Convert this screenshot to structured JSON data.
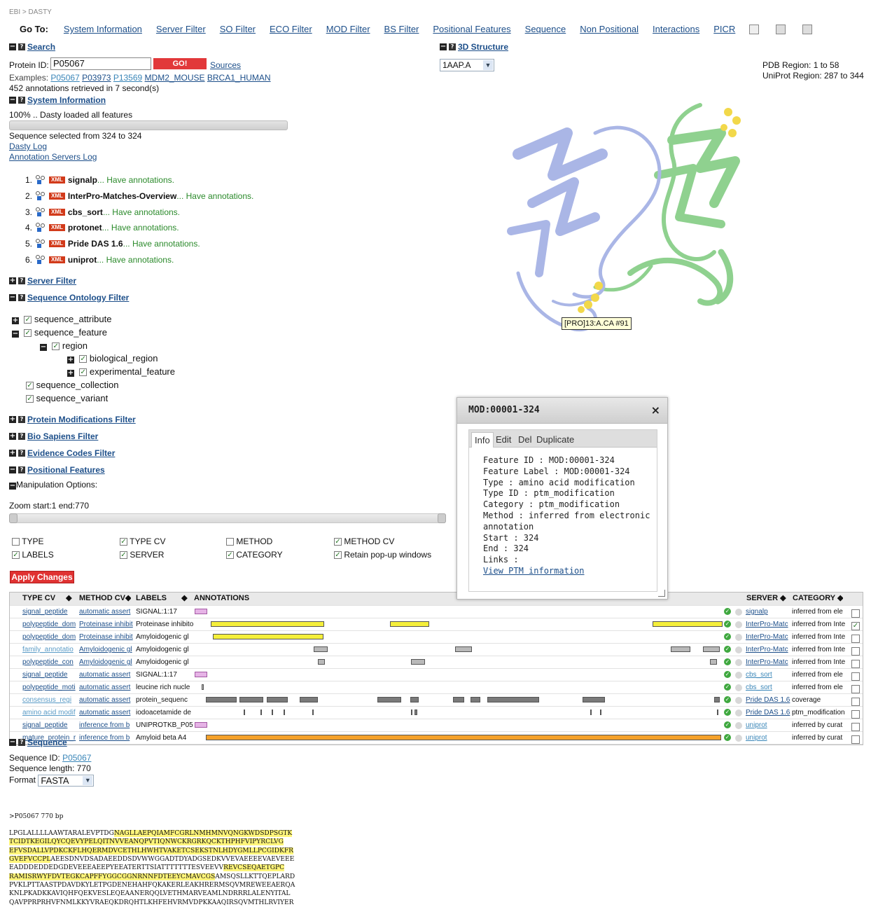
{
  "breadcrumb": "EBI > DASTY",
  "nav": {
    "label": "Go To:",
    "links": [
      "System Information",
      "Server Filter",
      "SO Filter",
      "ECO Filter",
      "MOD Filter",
      "BS Filter",
      "Positional Features",
      "Sequence",
      "Non Positional",
      "Interactions",
      "PICR"
    ]
  },
  "search": {
    "title": "Search",
    "protein_label": "Protein ID:",
    "protein_value": "P05067",
    "go_label": "GO!",
    "sources_label": "Sources",
    "examples_label": "Examples:",
    "examples": [
      "P05067",
      "P03973",
      "P13569",
      "MDM2_MOUSE",
      "BRCA1_HUMAN"
    ],
    "retrieved": "452 annotations retrieved in 7 second(s)"
  },
  "sysinfo": {
    "title": "System Information",
    "loaded": "100% .. Dasty loaded all features",
    "selected": "Sequence selected from 324 to 324",
    "dasty_log": "Dasty Log",
    "servers_log": "Annotation Servers Log",
    "sources": [
      {
        "num": "1.",
        "name": "signalp",
        "status": "... Have annotations.",
        "bold": true
      },
      {
        "num": "2.",
        "name": "InterPro-Matches-Overview",
        "status": "... Have annotations.",
        "bold": true
      },
      {
        "num": "3.",
        "name": "cbs_sort",
        "status": "... Have annotations.",
        "bold": true
      },
      {
        "num": "4.",
        "name": "protonet",
        "status": "... Have annotations.",
        "bold": true
      },
      {
        "num": "5.",
        "name": "Pride DAS 1.6",
        "status": "... Have annotations.",
        "bold": true
      },
      {
        "num": "6.",
        "name": "uniprot",
        "status": "... Have annotations.",
        "bold": true
      }
    ],
    "xml_badge": "XML"
  },
  "filters": {
    "server": "Server Filter",
    "so": "Sequence Ontology Filter",
    "tree": [
      "sequence_attribute",
      "sequence_feature",
      "region",
      "biological_region",
      "experimental_feature",
      "sequence_collection",
      "sequence_variant"
    ],
    "protmod": "Protein Modifications Filter",
    "biosap": "Bio Sapiens Filter",
    "evidence": "Evidence Codes Filter",
    "positional": "Positional Features"
  },
  "manipulation": {
    "title": "Manipulation Options:",
    "zoom": "Zoom start:1 end:770",
    "options": [
      "TYPE",
      "TYPE CV",
      "METHOD",
      "METHOD CV",
      "LABELS",
      "SERVER",
      "CATEGORY",
      "Retain pop-up windows"
    ],
    "checked": [
      false,
      true,
      false,
      true,
      true,
      true,
      true,
      true
    ],
    "apply": "Apply Changes"
  },
  "structure": {
    "title": "3D Structure",
    "select_value": "1AAP.A",
    "pdb_region": "PDB Region: 1 to 58",
    "uniprot_region": "UniProt Region: 287 to 344",
    "tooltip": "[PRO]13:A.CA #91",
    "colors": {
      "chain_a": "#aab6e6",
      "chain_b": "#8fd18f",
      "highlight": "#f2d84a"
    }
  },
  "popup": {
    "title": "MOD:00001-324",
    "close": "×",
    "tabs": [
      "Info",
      "Edit",
      "Del",
      "Duplicate"
    ],
    "lines": [
      "Feature ID : MOD:00001-324",
      "Feature Label : MOD:00001-324",
      "Type : amino acid modification",
      "Type ID : ptm_modification",
      "Category : ptm_modification",
      "Method : inferred from electronic",
      "annotation",
      "Start : 324",
      "End : 324",
      "Links :"
    ],
    "link": "View PTM information"
  },
  "table": {
    "headers": {
      "type_cv": "TYPE CV",
      "method_cv": "METHOD CV",
      "labels": "LABELS",
      "annotations": "ANNOTATIONS",
      "server": "SERVER",
      "category": "CATEGORY"
    },
    "rows": [
      {
        "type": "signal_peptide",
        "method": "automatic assert",
        "label": "SIGNAL:1:17",
        "server": "signalp",
        "cat": "inferred from ele",
        "checked": false
      },
      {
        "type": "polypeptide_dom",
        "method": "Proteinase inhibit",
        "label": "Proteinase inhibito",
        "server": "InterPro-Matc",
        "cat": "inferred from Inte",
        "checked": true
      },
      {
        "type": "polypeptide_dom",
        "method": "Proteinase inhibit",
        "label": "Amyloidogenic gl",
        "server": "InterPro-Matc",
        "cat": "inferred from Inte",
        "checked": false
      },
      {
        "type": "family_annotatio",
        "method": "Amyloidogenic gl",
        "label": "Amyloidogenic gl",
        "server": "InterPro-Matc",
        "cat": "inferred from Inte",
        "checked": false
      },
      {
        "type": "polypeptide_con",
        "method": "Amyloidogenic gl",
        "label": "Amyloidogenic gl",
        "server": "InterPro-Matc",
        "cat": "inferred from Inte",
        "checked": false
      },
      {
        "type": "signal_peptide",
        "method": "automatic assert",
        "label": "SIGNAL:1:17",
        "server": "cbs_sort",
        "cat": "inferred from ele",
        "checked": false
      },
      {
        "type": "polypeptide_moti",
        "method": "automatic assert",
        "label": "leucine rich nucle",
        "server": "cbs_sort",
        "cat": "inferred from ele",
        "checked": false
      },
      {
        "type": "consensus_regi",
        "method": "automatic assert",
        "label": "protein_sequenc",
        "server": "Pride DAS 1.6",
        "cat": "coverage",
        "checked": false
      },
      {
        "type": "amino acid modif",
        "method": "automatic assert",
        "label": "iodoacetamide de",
        "server": "Pride DAS 1.6",
        "cat": "ptm_modification",
        "checked": false
      },
      {
        "type": "signal_peptide",
        "method": "inference from b",
        "label": "UNIPROTKB_P05",
        "server": "uniprot",
        "cat": "inferred by curat",
        "checked": false
      },
      {
        "type": "mature_protein_r",
        "method": "inference from b",
        "label": "Amyloid beta A4",
        "server": "uniprot",
        "cat": "inferred by curat",
        "checked": false
      }
    ],
    "feature_colors": {
      "pink": "#e6b3e6",
      "yellow": "#f5ef3a",
      "grey": "#b9b9b9",
      "dark": "#7a7a7a",
      "orange": "#f5a12a"
    }
  },
  "sequence": {
    "title": "Sequence",
    "id_label": "Sequence ID:",
    "id_value": "P05067",
    "length": "Sequence length: 770",
    "format_label": "Format",
    "format_value": "FASTA",
    "header": ">P05067 770 bp",
    "lines": [
      [
        [
          "LPGLALLLLAAWTARALEVPTDG",
          false
        ],
        [
          "NAGLLAEPQIAMFCGRLNMHMNVQNGKWDSDPSGTK",
          true
        ]
      ],
      [
        [
          "TCIDTKEGILQYCQEVYPELQITNVVEANQPVTIQNWCKRGRKQCKTHPHFVIPYRCLVG",
          true
        ]
      ],
      [
        [
          "EFVSDALLVPDKCKFLHQERMDVCETHLHWHTVAKETCSEKSTNLHDYGMLLPCGIDKFR",
          true
        ]
      ],
      [
        [
          "GVEFVCCPL",
          true
        ],
        [
          "AEESDNVDSADAEEDDSDVWWGGADTDYADGSEDKVVEVAEEEEVAEVEEE",
          false
        ]
      ],
      [
        [
          "EADDDEDDEDGDEVEEEAEEPYEEATERTTSIATTTTTTTESVEEVV",
          false
        ],
        [
          "REVCSEQAETGPC",
          true
        ]
      ],
      [
        [
          "RAMISRWYFDVTEGKCAPFFYGGCGGNRNNFDTEEYCMAVCGS",
          true
        ],
        [
          "AMSQSLLKTTQEPLARD",
          false
        ]
      ],
      [
        [
          "PVKLPTTAASTPDAVDKYLETPGDENEHAHFQKAKERLEAKHRERMSQVMREWEEAERQA",
          false
        ]
      ],
      [
        [
          "KNLPKADKKAVIQHFQEKVESLEQEAANERQQLVETHMARVEAMLNDRRRLALENYITAL",
          false
        ]
      ],
      [
        [
          "QAVPPRPRHVFNMLKKYVRAEQKDRQHTLKHFEHVRMVDPKKAAQIRSQVMTHLRVIYER",
          false
        ]
      ]
    ]
  }
}
